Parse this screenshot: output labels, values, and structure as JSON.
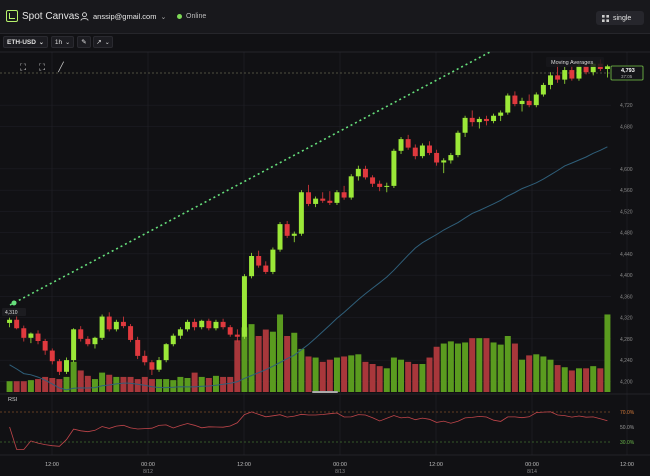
{
  "header": {
    "app_name": "Spot Canvas",
    "user_email": "anssip@gmail.com",
    "status": "Online",
    "layout_button": "single"
  },
  "toolbar": {
    "symbol": "ETH-USD",
    "interval": "1h"
  },
  "indicators": {
    "legend": "Moving Averages",
    "rsi_label": "RSI"
  },
  "price_axis": {
    "labels": [
      "4,720",
      "4,680",
      "4,600",
      "4,560",
      "4,520",
      "4,480",
      "4,440",
      "4,400",
      "4,360",
      "4,320",
      "4,280",
      "4,240",
      "4,200"
    ],
    "current_price": "4,793",
    "current_sub": "37:05",
    "left_marker": "4,310"
  },
  "rsi_axis": {
    "labels": [
      "70.0%",
      "50.0%",
      "30.0%"
    ]
  },
  "time_axis": {
    "labels": [
      {
        "text": "12:00",
        "sub": ""
      },
      {
        "text": "00:00",
        "sub": "8/12"
      },
      {
        "text": "12:00",
        "sub": ""
      },
      {
        "text": "00:00",
        "sub": "8/13"
      },
      {
        "text": "12:00",
        "sub": ""
      },
      {
        "text": "00:00",
        "sub": "8/14"
      },
      {
        "text": "12:00",
        "sub": ""
      }
    ]
  },
  "colors": {
    "up": "#9be838",
    "down": "#e0393e",
    "trendline": "#66e07c",
    "ma": "#2f5f7a",
    "rsi": "#c0454a"
  },
  "chart_data": {
    "type": "candlestick",
    "candles": [
      [
        4310,
        4320,
        4302,
        4316
      ],
      [
        4316,
        4322,
        4298,
        4300
      ],
      [
        4300,
        4305,
        4275,
        4282
      ],
      [
        4282,
        4292,
        4272,
        4290
      ],
      [
        4290,
        4296,
        4270,
        4276
      ],
      [
        4276,
        4280,
        4250,
        4258
      ],
      [
        4258,
        4262,
        4232,
        4238
      ],
      [
        4238,
        4242,
        4212,
        4218
      ],
      [
        4218,
        4245,
        4214,
        4240
      ],
      [
        4240,
        4300,
        4236,
        4298
      ],
      [
        4298,
        4304,
        4275,
        4280
      ],
      [
        4280,
        4285,
        4266,
        4270
      ],
      [
        4270,
        4284,
        4262,
        4282
      ],
      [
        4282,
        4326,
        4278,
        4322
      ],
      [
        4322,
        4330,
        4294,
        4298
      ],
      [
        4298,
        4316,
        4294,
        4312
      ],
      [
        4312,
        4322,
        4300,
        4304
      ],
      [
        4304,
        4308,
        4274,
        4278
      ],
      [
        4278,
        4284,
        4242,
        4248
      ],
      [
        4248,
        4258,
        4230,
        4236
      ],
      [
        4236,
        4240,
        4212,
        4222
      ],
      [
        4222,
        4246,
        4218,
        4240
      ],
      [
        4240,
        4272,
        4236,
        4270
      ],
      [
        4270,
        4290,
        4266,
        4286
      ],
      [
        4286,
        4302,
        4280,
        4298
      ],
      [
        4298,
        4316,
        4294,
        4312
      ],
      [
        4312,
        4318,
        4296,
        4302
      ],
      [
        4302,
        4316,
        4298,
        4314
      ],
      [
        4314,
        4318,
        4296,
        4300
      ],
      [
        4300,
        4316,
        4296,
        4312
      ],
      [
        4312,
        4318,
        4298,
        4302
      ],
      [
        4302,
        4306,
        4284,
        4288
      ],
      [
        4288,
        4298,
        4274,
        4284
      ],
      [
        4284,
        4402,
        4280,
        4398
      ],
      [
        4398,
        4442,
        4394,
        4436
      ],
      [
        4436,
        4446,
        4414,
        4418
      ],
      [
        4418,
        4426,
        4402,
        4406
      ],
      [
        4406,
        4452,
        4402,
        4448
      ],
      [
        4448,
        4500,
        4444,
        4496
      ],
      [
        4496,
        4502,
        4470,
        4474
      ],
      [
        4474,
        4482,
        4462,
        4478
      ],
      [
        4478,
        4560,
        4474,
        4556
      ],
      [
        4556,
        4570,
        4530,
        4534
      ],
      [
        4534,
        4548,
        4528,
        4544
      ],
      [
        4544,
        4556,
        4536,
        4540
      ],
      [
        4540,
        4558,
        4532,
        4536
      ],
      [
        4536,
        4560,
        4532,
        4556
      ],
      [
        4556,
        4568,
        4542,
        4546
      ],
      [
        4546,
        4590,
        4542,
        4586
      ],
      [
        4586,
        4606,
        4578,
        4600
      ],
      [
        4600,
        4606,
        4580,
        4584
      ],
      [
        4584,
        4588,
        4566,
        4572
      ],
      [
        4572,
        4578,
        4558,
        4566
      ],
      [
        4566,
        4574,
        4556,
        4568
      ],
      [
        4568,
        4638,
        4564,
        4634
      ],
      [
        4634,
        4660,
        4628,
        4656
      ],
      [
        4656,
        4664,
        4636,
        4640
      ],
      [
        4640,
        4646,
        4618,
        4624
      ],
      [
        4624,
        4648,
        4620,
        4644
      ],
      [
        4644,
        4652,
        4626,
        4630
      ],
      [
        4630,
        4636,
        4606,
        4612
      ],
      [
        4612,
        4620,
        4592,
        4616
      ],
      [
        4616,
        4630,
        4610,
        4626
      ],
      [
        4626,
        4672,
        4622,
        4668
      ],
      [
        4668,
        4700,
        4660,
        4696
      ],
      [
        4696,
        4710,
        4680,
        4688
      ],
      [
        4688,
        4698,
        4676,
        4694
      ],
      [
        4694,
        4700,
        4682,
        4690
      ],
      [
        4690,
        4704,
        4686,
        4700
      ],
      [
        4700,
        4710,
        4690,
        4706
      ],
      [
        4706,
        4742,
        4702,
        4738
      ],
      [
        4738,
        4746,
        4718,
        4722
      ],
      [
        4722,
        4734,
        4708,
        4728
      ],
      [
        4728,
        4740,
        4716,
        4720
      ],
      [
        4720,
        4744,
        4716,
        4740
      ],
      [
        4740,
        4762,
        4736,
        4758
      ],
      [
        4758,
        4782,
        4750,
        4776
      ],
      [
        4776,
        4800,
        4762,
        4768
      ],
      [
        4768,
        4792,
        4760,
        4786
      ],
      [
        4786,
        4794,
        4766,
        4770
      ],
      [
        4770,
        4798,
        4766,
        4794
      ],
      [
        4794,
        4800,
        4778,
        4782
      ],
      [
        4782,
        4800,
        4776,
        4798
      ],
      [
        4798,
        4806,
        4784,
        4788
      ],
      [
        4788,
        4796,
        4772,
        4793
      ]
    ],
    "volume": [
      10,
      10,
      10,
      11,
      12,
      14,
      13,
      12,
      14,
      28,
      20,
      15,
      12,
      18,
      16,
      14,
      14,
      14,
      12,
      14,
      12,
      12,
      12,
      11,
      14,
      13,
      18,
      14,
      13,
      15,
      14,
      14,
      48,
      60,
      63,
      52,
      58,
      56,
      72,
      52,
      55,
      40,
      33,
      32,
      28,
      30,
      32,
      33,
      34,
      35,
      28,
      26,
      24,
      22,
      32,
      30,
      28,
      26,
      26,
      32,
      42,
      45,
      47,
      45,
      46,
      50,
      50,
      50,
      46,
      44,
      52,
      45,
      30,
      34,
      35,
      33,
      30,
      25,
      23,
      20,
      22,
      22,
      24,
      22,
      72
    ]
  }
}
